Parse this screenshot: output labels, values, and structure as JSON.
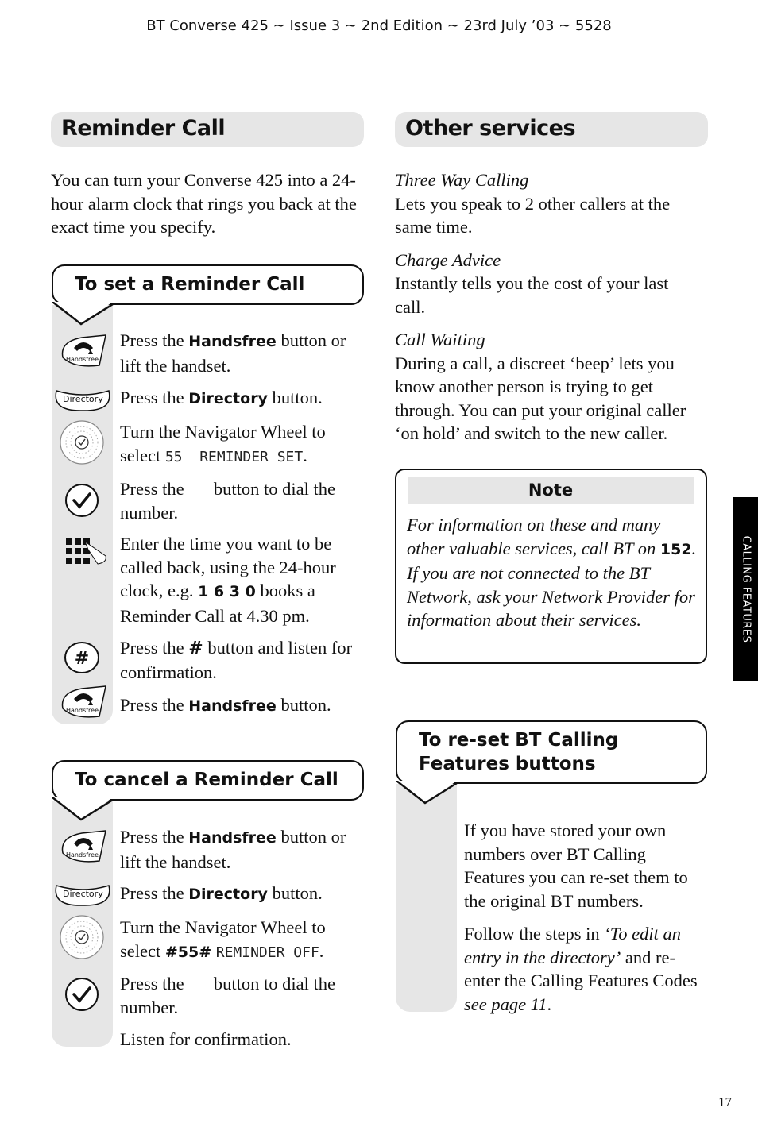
{
  "running_head": "BT Converse 425 ~ Issue 3 ~ 2nd Edition ~ 23rd July ’03 ~ 5528",
  "left": {
    "title": "Reminder Call",
    "intro": "You can turn your Converse 425 into a 24-hour alarm clock that rings you back at the exact time you specify.",
    "set_box": {
      "title": "To set a Reminder Call",
      "steps": [
        {
          "icon": "handsfree-button-icon",
          "icon_label": "Handsfree",
          "pre": "Press the ",
          "bold": "Handsfree",
          "post": " button or lift the handset."
        },
        {
          "icon": "directory-button-icon",
          "icon_label": "Directory",
          "pre": "Press the ",
          "bold": "Directory",
          "post": " button."
        },
        {
          "icon": "navigator-wheel-icon",
          "pre": "Turn the Navigator Wheel to select ",
          "display": "55  REMINDER SET",
          "post": "."
        },
        {
          "icon": "ok-check-button-icon",
          "pre": "Press the ",
          "post": " button to dial the number."
        },
        {
          "icon": "keypad-icon",
          "pre": "Enter the time you want to be called back, using the 24-hour clock, e.g. ",
          "bold": "1 6 3 0",
          "post": " books a Reminder Call at 4.30 pm."
        },
        {
          "icon": "hash-button-icon",
          "pre": "Press the ",
          "bold": "#",
          "post": " button and listen for confirmation."
        },
        {
          "icon": "handsfree-button-icon",
          "icon_label": "Handsfree",
          "pre": "Press the ",
          "bold": "Handsfree",
          "post": " button."
        }
      ]
    },
    "cancel_box": {
      "title": "To cancel a Reminder Call",
      "steps": [
        {
          "icon": "handsfree-button-icon",
          "icon_label": "Handsfree",
          "pre": "Press the ",
          "bold": "Handsfree",
          "post": " button or lift the handset."
        },
        {
          "icon": "directory-button-icon",
          "icon_label": "Directory",
          "pre": "Press the ",
          "bold": "Directory",
          "post": " button."
        },
        {
          "icon": "navigator-wheel-icon",
          "pre": "Turn the Navigator Wheel to select ",
          "bold": "#55#",
          "display": "REMINDER OFF",
          "post": "."
        },
        {
          "icon": "ok-check-button-icon",
          "pre": "Press the ",
          "post": " button to dial the number."
        },
        {
          "pre": "Listen for confirmation."
        }
      ]
    }
  },
  "right": {
    "title": "Other services",
    "services": [
      {
        "name": "Three Way Calling",
        "desc": "Lets you speak to 2 other callers at the same time."
      },
      {
        "name": "Charge Advice",
        "desc": "Instantly tells you the cost of your last call."
      },
      {
        "name": "Call Waiting",
        "desc": "During a call, a discreet ‘beep’ lets you know another person is trying to get through. You can put your original caller ‘on hold’ and switch to the new caller."
      }
    ],
    "note": {
      "heading": "Note",
      "text_pre": "For information on these and many other valuable services, call BT on ",
      "number": "152",
      "text_post": ". If you are not connected to the BT Network, ask your Network Provider for information about their services."
    },
    "reset_box": {
      "title": "To re-set BT Calling Features buttons",
      "para1": "If you have stored your own numbers over BT Calling Features you can re-set them to the original BT numbers.",
      "para2_pre": "Follow the steps in ",
      "para2_ital": "‘To edit an entry in the directory’",
      "para2_mid": " and re-enter the Calling Features Codes ",
      "para2_ref": "see page 11",
      "para2_end": "."
    }
  },
  "side_tab": "CALLING FEATURES",
  "page_number": "17"
}
